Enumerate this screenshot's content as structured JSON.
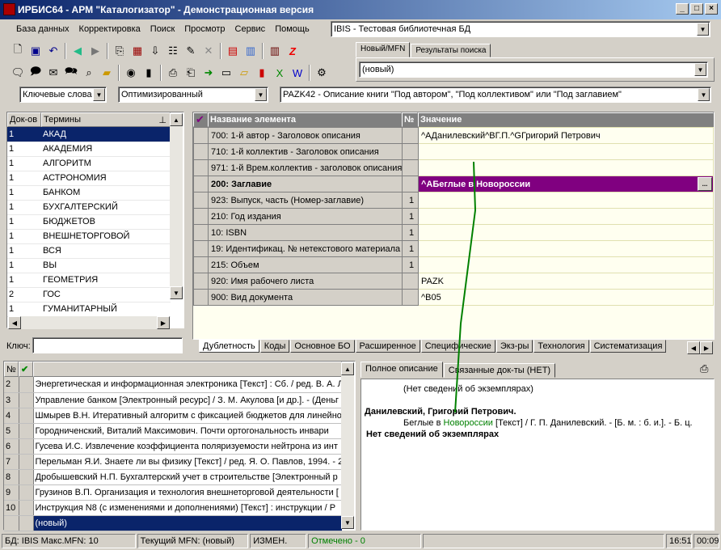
{
  "window": {
    "title": "ИРБИС64 - АРМ \"Каталогизатор\" - Демонстрационная версия",
    "min": "_",
    "max": "□",
    "close": "×"
  },
  "menu": [
    "База данных",
    "Корректировка",
    "Поиск",
    "Просмотр",
    "Сервис",
    "Помощь"
  ],
  "db_combo": {
    "value": "IBIS - Тестовая библиотечная БД"
  },
  "record_tabs": [
    "Новый/MFN",
    "Результаты поиска"
  ],
  "record_combo": {
    "value": "(новый)"
  },
  "search_bar": {
    "mode": "Ключевые слова",
    "mode2": "Оптимизированный",
    "worksheet": "PAZK42 - Описание книги \"Под автором\", \"Под коллективом\" или \"Под заглавием\""
  },
  "terms": {
    "col_docs": "Док-ов",
    "col_terms": "Термины",
    "rows": [
      {
        "n": "1",
        "t": "АКАД"
      },
      {
        "n": "1",
        "t": "АКАДЕМИЯ"
      },
      {
        "n": "1",
        "t": "АЛГОРИТМ"
      },
      {
        "n": "1",
        "t": "АСТРОНОМИЯ"
      },
      {
        "n": "1",
        "t": "БАНКОМ"
      },
      {
        "n": "1",
        "t": "БУХГАЛТЕРСКИЙ"
      },
      {
        "n": "1",
        "t": "БЮДЖЕТОВ"
      },
      {
        "n": "1",
        "t": "ВНЕШНЕТОРГОВОЙ"
      },
      {
        "n": "1",
        "t": "ВСЯ"
      },
      {
        "n": "1",
        "t": "ВЫ"
      },
      {
        "n": "1",
        "t": "ГЕОМЕТРИЯ"
      },
      {
        "n": "2",
        "t": "ГОС"
      },
      {
        "n": "1",
        "t": "ГУМАНИТАРНЫЙ"
      }
    ],
    "key_label": "Ключ:"
  },
  "fields": {
    "col_name": "Название элемента",
    "col_num": "№",
    "col_value": "Значение",
    "rows": [
      {
        "name": "700: 1-й автор - Заголовок описания",
        "num": "",
        "value": "^AДанилевский^BГ.П.^GГригорий Петрович"
      },
      {
        "name": "710: 1-й коллектив - Заголовок описания",
        "num": "",
        "value": ""
      },
      {
        "name": "971: 1-й Врем.коллектив - заголовок описания",
        "num": "",
        "value": ""
      },
      {
        "name": "200: Заглавие",
        "num": "",
        "value": "^AБеглые в Новороссии"
      },
      {
        "name": "923: Выпуск, часть (Номер-заглавие)",
        "num": "1",
        "value": ""
      },
      {
        "name": "210: Год издания",
        "num": "1",
        "value": ""
      },
      {
        "name": "10: ISBN",
        "num": "1",
        "value": ""
      },
      {
        "name": "19: Идентификац. № нетекстового материала",
        "num": "1",
        "value": ""
      },
      {
        "name": "215: Объем",
        "num": "1",
        "value": ""
      },
      {
        "name": "920: Имя рабочего листа",
        "num": "",
        "value": "PAZK"
      },
      {
        "name": "900: Вид документа",
        "num": "",
        "value": "^B05"
      }
    ],
    "ellipsis": "..."
  },
  "bottom_tabs": [
    "Дублетность",
    "Коды",
    "Основное БО",
    "Расширенное",
    "Специфические",
    "Экз-ры",
    "Технология",
    "Систематизация"
  ],
  "records": {
    "col_n": "№",
    "rows": [
      {
        "n": "2",
        "text": "Энергетическая и информационная электроника [Текст] : Сб. / ред. В. А. Л"
      },
      {
        "n": "3",
        "text": "Управление банком [Электронный ресурс]  / З. М. Акулова [и др.]. - (Деньг"
      },
      {
        "n": "4",
        "text": "Шмырев В.Н. Итеративный алгоритм с фиксацией бюджетов для линейно"
      },
      {
        "n": "5",
        "text": "Городниченский, Виталий Максимович. Почти ортогональность инвари"
      },
      {
        "n": "6",
        "text": "Гусева И.С. Извлечение коэффициента поляризуемости нейтрона из инт"
      },
      {
        "n": "7",
        "text": "Перельман Я.И. Знаете ли вы физику [Текст] / ред. Я. О. Павлов, 1994. - 2"
      },
      {
        "n": "8",
        "text": "Дробышевский Н.П. Бухгалтерский учет в строительстве [Электронный р"
      },
      {
        "n": "9",
        "text": "Грузинов В.П. Организация и технология внешнеторговой деятельности ["
      },
      {
        "n": "10",
        "text": "Инструкция N8   (с изменениями и дополнениями) [Текст] : инструкции / Р"
      },
      {
        "n": "",
        "text": "(новый)"
      }
    ]
  },
  "desc_tabs": [
    "Полное описание",
    "Связанные док-ты (НЕТ)"
  ],
  "description": {
    "no_copies_top": "(Нет сведений об экземплярах)",
    "author": "Данилевский, Григорий Петрович.",
    "body_pre": "Беглые в ",
    "body_link": "Новороссии",
    "body_post": " [Текст] / Г. П. Данилевский. - [Б. м. : б. и.]. - Б. ц.",
    "no_copies": "Нет сведений об экземплярах"
  },
  "status": {
    "db": "БД: IBIS Макс.MFN: 10",
    "current": "Текущий MFN: (новый)",
    "changed": "ИЗМЕН.",
    "marked": "Отмечено - 0",
    "time": "16:51",
    "elapsed": "00:09"
  },
  "colors": {
    "selection": "#0a246a",
    "editing": "#800080",
    "field_value": "#fffff0",
    "link": "#008000"
  }
}
